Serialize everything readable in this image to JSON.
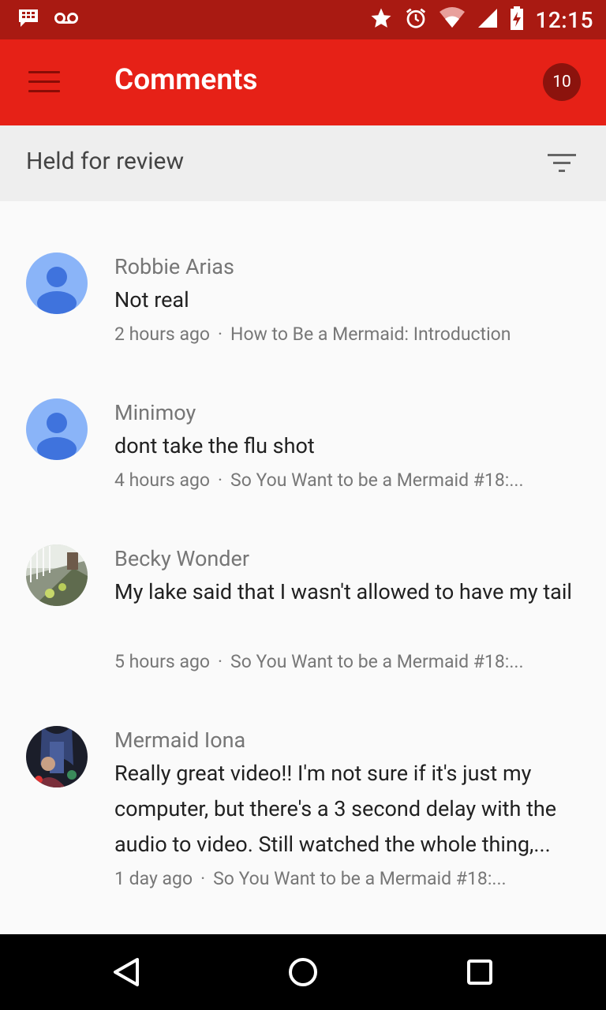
{
  "status_bar": {
    "time": "12:15",
    "icons": [
      "bbm-icon",
      "voicemail-icon",
      "star-icon",
      "alarm-icon",
      "wifi-icon",
      "cell-signal-icon",
      "battery-charging-icon"
    ]
  },
  "app_bar": {
    "title": "Comments",
    "badge_count": "10",
    "menu_icon": "hamburger-menu-icon"
  },
  "filter_bar": {
    "label": "Held for review",
    "filter_icon": "filter-icon"
  },
  "comments": [
    {
      "author": "Robbie Arias",
      "text": "Not real",
      "time": "2 hours ago",
      "separator": "·",
      "video": "How to Be a Mermaid: Introduction",
      "avatar": "default-person-avatar"
    },
    {
      "author": "Minimoy",
      "text": "dont take the flu shot",
      "time": "4 hours ago",
      "separator": "·",
      "video": "So You Want to be a Mermaid #18:...",
      "avatar": "default-person-avatar"
    },
    {
      "author": "Becky Wonder",
      "text": "My lake said that I wasn't allowed to have my tail",
      "time": "5 hours ago",
      "separator": "·",
      "video": "So You Want to be a Mermaid #18:...",
      "avatar": "photo-avatar"
    },
    {
      "author": "Mermaid Iona",
      "text": "Really great video!! I'm not sure if it's just my computer, but there's a 3 second delay with the audio to video. Still watched the whole thing,...",
      "time": "1 day ago",
      "separator": "·",
      "video": "So You Want to be a Mermaid #18:...",
      "avatar": "photo-avatar"
    }
  ],
  "nav_bar": {
    "icons": [
      "back-icon",
      "home-icon",
      "recents-icon"
    ]
  },
  "colors": {
    "status_bar": "#a91a12",
    "app_bar": "#e62117",
    "badge": "#8c130d",
    "filter_bar": "#eeeeee",
    "background": "#fafafa",
    "default_avatar_bg": "#8ab4f8",
    "default_avatar_fg": "#3f73dd"
  }
}
